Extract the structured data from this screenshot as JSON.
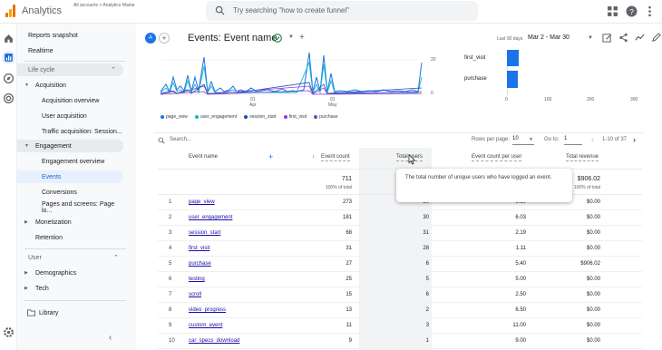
{
  "app": {
    "name": "Analytics",
    "breadcrumb": "All accounts > Analytics Mania",
    "property": ""
  },
  "search": {
    "placeholder": "Try searching \"how to create funnel\""
  },
  "nav": {
    "items": [
      {
        "label": "Reports snapshot"
      },
      {
        "label": "Realtime"
      },
      {
        "label": "Life cycle"
      },
      {
        "label": "Acquisition"
      },
      {
        "label": "Acquisition overview"
      },
      {
        "label": "User acquisition"
      },
      {
        "label": "Traffic acquisition: Session..."
      },
      {
        "label": "Engagement"
      },
      {
        "label": "Engagement overview"
      },
      {
        "label": "Events"
      },
      {
        "label": "Conversions"
      },
      {
        "label": "Pages and screens: Page lo..."
      },
      {
        "label": "Monetization"
      },
      {
        "label": "Retention"
      },
      {
        "label": "User"
      },
      {
        "label": "Demographics"
      },
      {
        "label": "Tech"
      },
      {
        "label": "Library"
      }
    ]
  },
  "header": {
    "avatar": "A",
    "title": "Events: Event name",
    "date_label": "Last 90 days",
    "date_range": "Mar 2 - Mar 30"
  },
  "chart": {
    "y_ticks": [
      "20",
      "0"
    ],
    "x_ticks": [
      {
        "day": "01",
        "month": "Apr"
      },
      {
        "day": "01",
        "month": "May"
      }
    ],
    "legend": [
      {
        "label": "page_view",
        "color": "#1a73e8"
      },
      {
        "label": "user_engagement",
        "color": "#12b5cb"
      },
      {
        "label": "session_start",
        "color": "#174ea6"
      },
      {
        "label": "first_visit",
        "color": "#9334e6"
      },
      {
        "label": "purchase",
        "color": "#6f42c1"
      }
    ],
    "bars": [
      {
        "label": "first_visit",
        "value": 31
      },
      {
        "label": "purchase",
        "value": 27
      }
    ],
    "bar_ticks": [
      "0",
      "100",
      "200",
      "300"
    ]
  },
  "table_toolbar": {
    "search": "Search...",
    "rows_label": "Rows per page:",
    "rows_value": "10",
    "goto_label": "Go to:",
    "goto_value": "1",
    "pager": "1-10 of 37"
  },
  "table": {
    "columns": [
      "Event name",
      "Event count",
      "Total users",
      "Event count per user",
      "Total revenue"
    ],
    "totals": {
      "event_count": "711",
      "event_count_sub": "100% of total",
      "revenue": "$906.02",
      "revenue_sub": "100% of total"
    },
    "rows": [
      {
        "idx": "1",
        "name": "page_view",
        "count": "273",
        "users": "30",
        "per_user": "9.10",
        "revenue": "$0.00"
      },
      {
        "idx": "2",
        "name": "user_engagement",
        "count": "181",
        "users": "30",
        "per_user": "6.03",
        "revenue": "$0.00"
      },
      {
        "idx": "3",
        "name": "session_start",
        "count": "68",
        "users": "31",
        "per_user": "2.19",
        "revenue": "$0.00"
      },
      {
        "idx": "4",
        "name": "first_visit",
        "count": "31",
        "users": "28",
        "per_user": "1.11",
        "revenue": "$0.00"
      },
      {
        "idx": "5",
        "name": "purchase",
        "count": "27",
        "users": "6",
        "per_user": "5.40",
        "revenue": "$906.02"
      },
      {
        "idx": "6",
        "name": "testing",
        "count": "25",
        "users": "5",
        "per_user": "5.00",
        "revenue": "$0.00"
      },
      {
        "idx": "7",
        "name": "scroll",
        "count": "15",
        "users": "6",
        "per_user": "2.50",
        "revenue": "$0.00"
      },
      {
        "idx": "8",
        "name": "video_progress",
        "count": "13",
        "users": "2",
        "per_user": "6.50",
        "revenue": "$0.00"
      },
      {
        "idx": "9",
        "name": "custom_event",
        "count": "11",
        "users": "3",
        "per_user": "11.00",
        "revenue": "$0.00"
      },
      {
        "idx": "10",
        "name": "car_specs_download",
        "count": "9",
        "users": "1",
        "per_user": "9.00",
        "revenue": "$0.00"
      }
    ]
  },
  "tooltip": {
    "text": "The total number of unique users who have logged an event."
  }
}
